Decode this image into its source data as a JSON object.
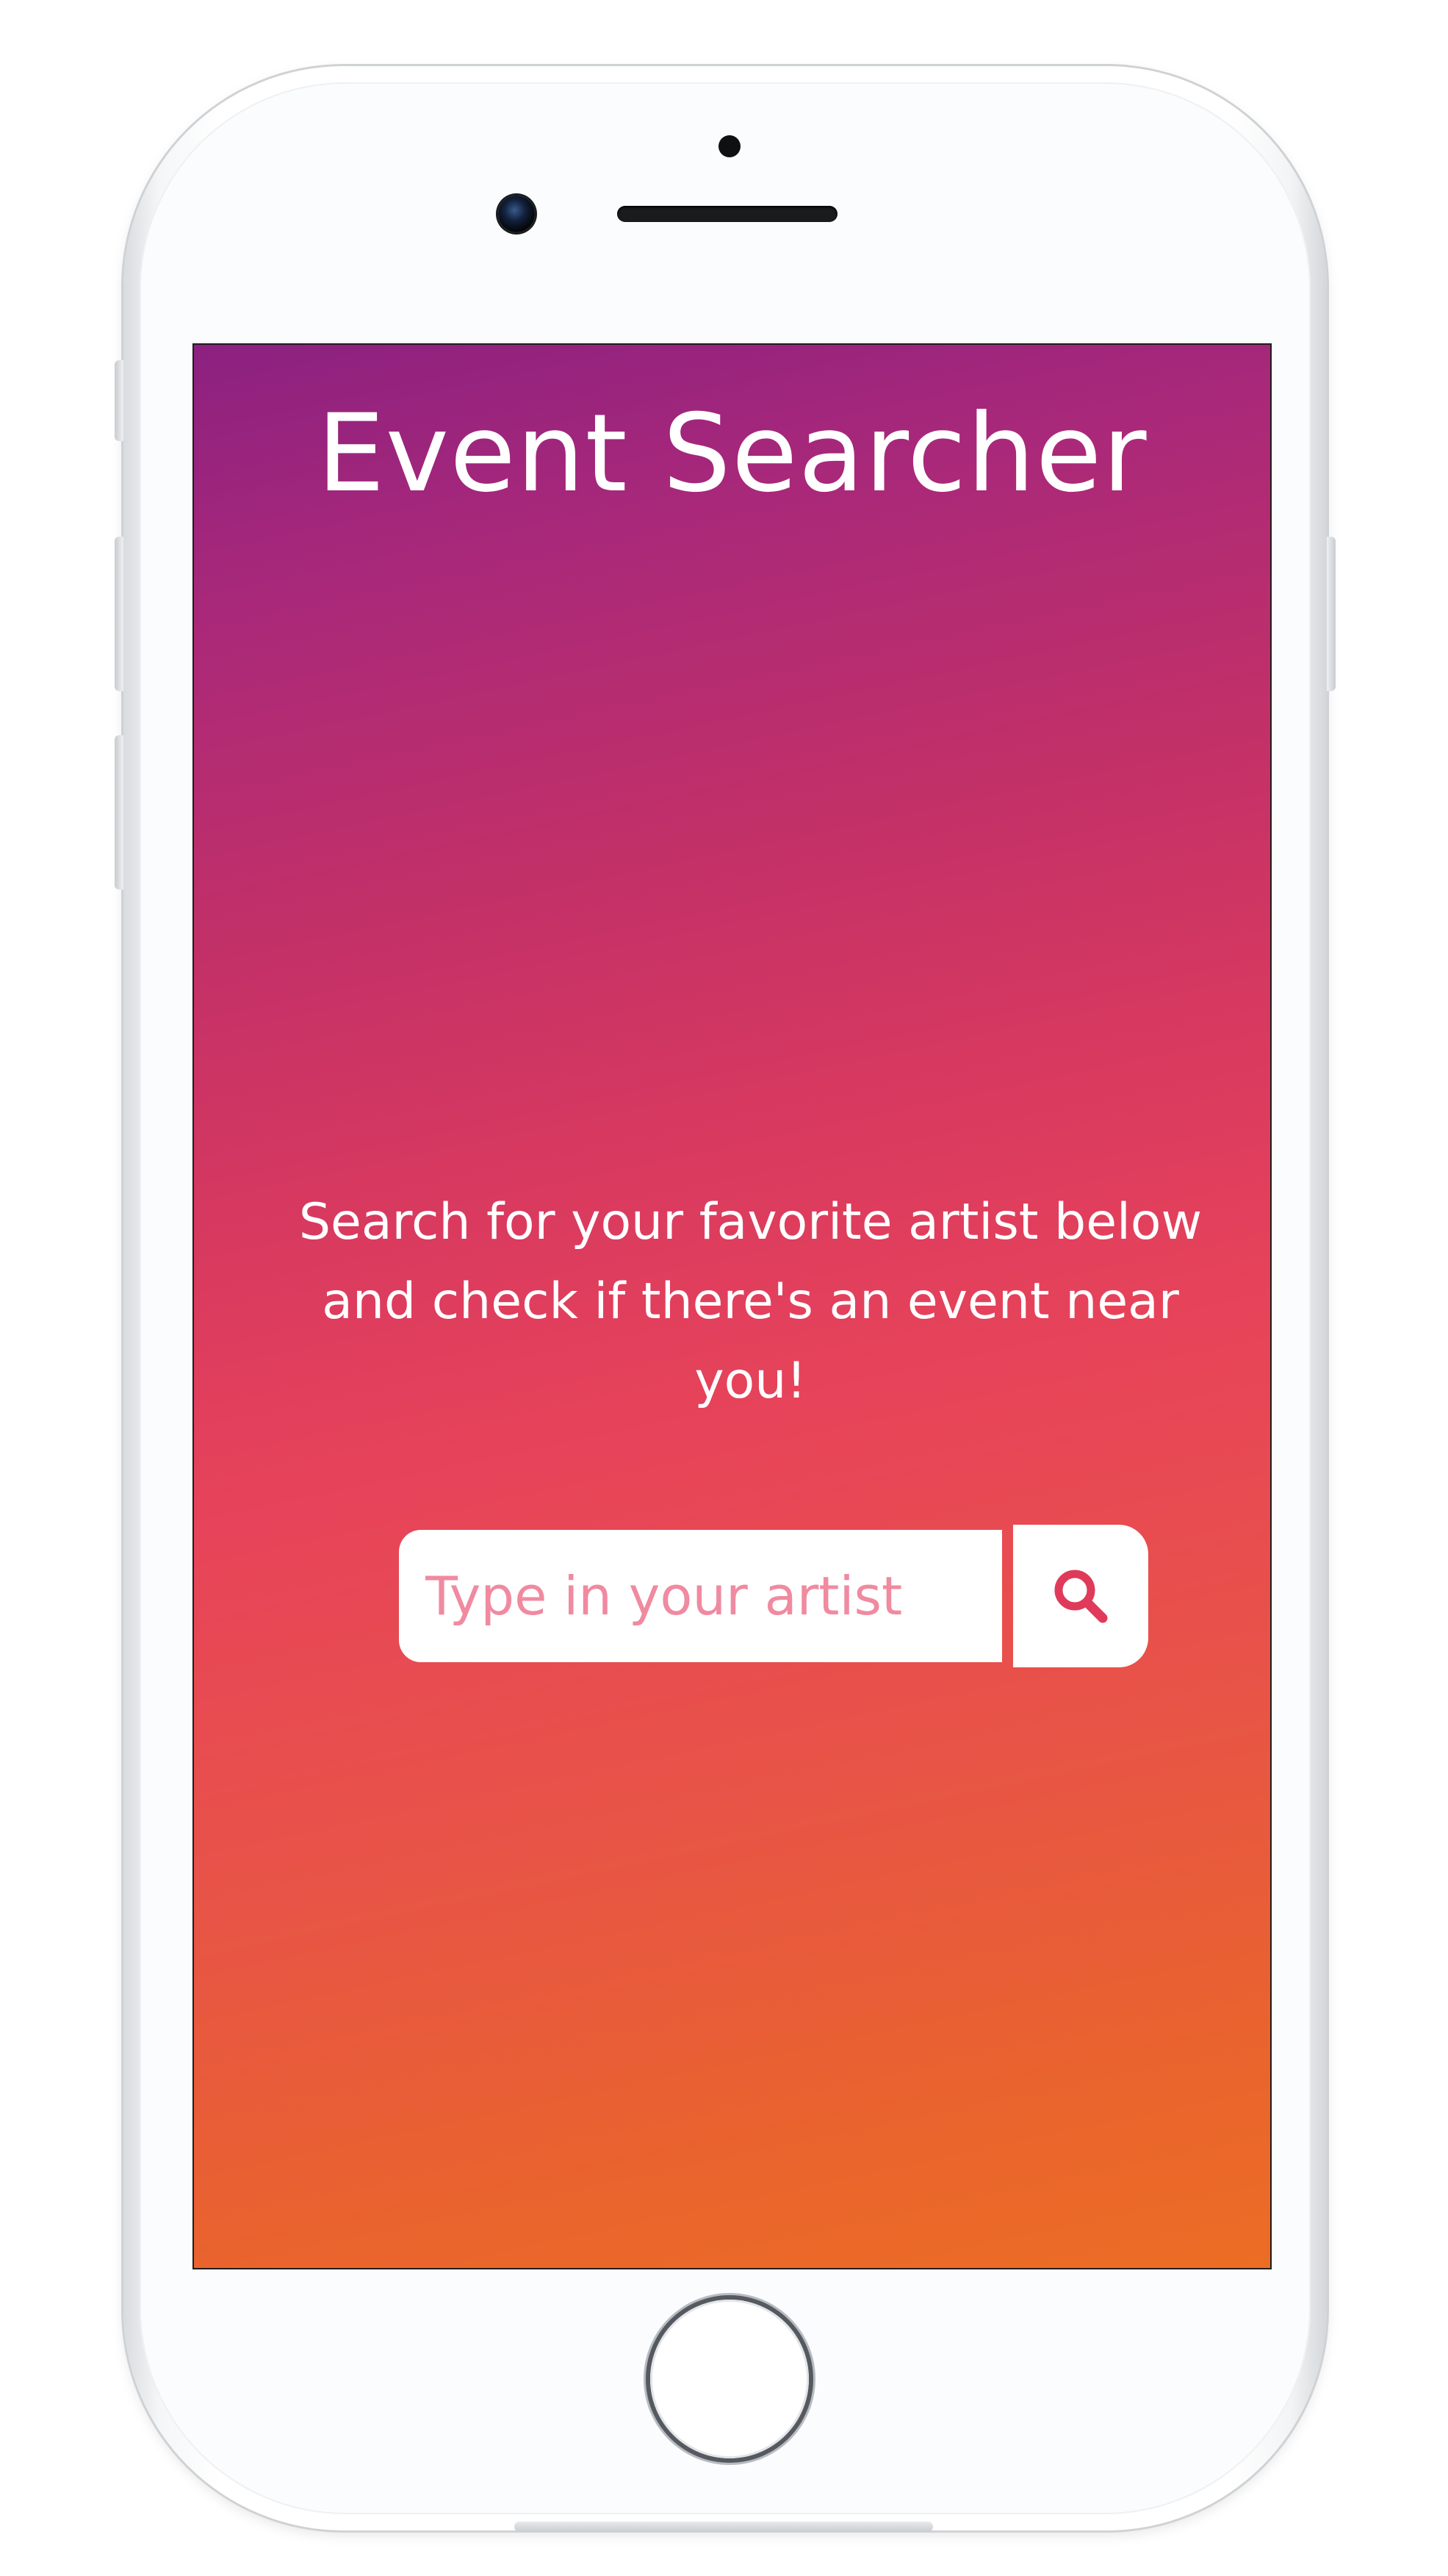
{
  "app": {
    "title": "Event Searcher",
    "intro": "Search for your favorite artist below and check if there's an event near you!"
  },
  "search": {
    "placeholder": "Type in your artist",
    "value": "",
    "button_icon": "search-icon"
  },
  "colors": {
    "gradient_top": "#8c2180",
    "gradient_middle": "#e7435a",
    "gradient_bottom": "#ec6d24",
    "accent": "#e03a5a",
    "placeholder": "#f08aa0"
  }
}
